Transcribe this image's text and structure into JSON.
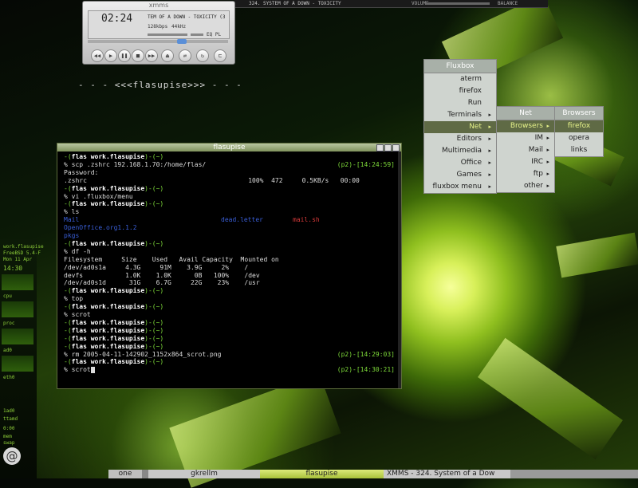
{
  "xmms": {
    "title": "xmms",
    "time": "02:24",
    "song": "TEM OF A DOWN - TOXICITY (3:3",
    "kbps": "128kbps",
    "khz": "44kHz",
    "eq_label": "EQ",
    "pl_label": "PL",
    "buttons": [
      "◀◀",
      "▶",
      "❚❚",
      "■",
      "▶▶",
      "⏏",
      "⇄",
      "↻",
      "⊏"
    ]
  },
  "topstrip": {
    "track": "324. SYSTEM OF A DOWN - TOXICITY",
    "volume": "VOLUME",
    "balance": "BALANCE"
  },
  "banner": "- - - <<<flasupise>>> - - -",
  "fluxbox_menu": {
    "title": "Fluxbox",
    "items": [
      "aterm",
      "firefox",
      "Run",
      "Terminals",
      "Net",
      "Editors",
      "Multimedia",
      "Office",
      "Games",
      "fluxbox menu"
    ],
    "submenu_items": [
      false,
      false,
      false,
      true,
      true,
      true,
      true,
      true,
      true,
      true
    ]
  },
  "net_menu": {
    "title": "Net",
    "items": [
      "Browsers",
      "IM",
      "Mail",
      "IRC",
      "ftp",
      "other"
    ]
  },
  "browsers_menu": {
    "title": "Browsers",
    "items": [
      "firefox",
      "opera",
      "links"
    ]
  },
  "terminal": {
    "title": "flasupise",
    "prompt_host": "flas work.flasupise",
    "lines": [
      {
        "prompt": true,
        "cmd": ""
      },
      {
        "prompt": false,
        "cmd": "% scp .zshrc 192.168.1.70:/home/flas/"
      },
      {
        "prompt": false,
        "cmd": "Password:"
      },
      {
        "prompt": false,
        "cmd": ".zshrc                                          100%  472     0.5KB/s   00:00"
      },
      {
        "prompt": true,
        "cmd": ""
      },
      {
        "prompt": false,
        "cmd": "% vi .fluxbox/menu"
      },
      {
        "prompt": true,
        "cmd": ""
      },
      {
        "prompt": false,
        "cmd": "% ls"
      },
      {
        "prompt": false,
        "cmd": "Mail"
      },
      {
        "prompt": false,
        "cmd": "OpenOffice.org1.1.2"
      },
      {
        "prompt": false,
        "cmd": "pkgs"
      },
      {
        "prompt": true,
        "cmd": ""
      },
      {
        "prompt": false,
        "cmd": "% df -h"
      },
      {
        "prompt": false,
        "cmd": "Filesystem     Size    Used   Avail Capacity  Mounted on"
      },
      {
        "prompt": false,
        "cmd": "/dev/ad0s1a     4.3G     91M    3.9G     2%    /"
      },
      {
        "prompt": false,
        "cmd": "devfs           1.0K    1.0K      0B   100%    /dev"
      },
      {
        "prompt": false,
        "cmd": "/dev/ad0s1d      31G    6.7G     22G    23%    /usr"
      },
      {
        "prompt": true,
        "cmd": ""
      },
      {
        "prompt": false,
        "cmd": "% top"
      },
      {
        "prompt": true,
        "cmd": ""
      },
      {
        "prompt": false,
        "cmd": "% scrot"
      },
      {
        "prompt": true,
        "cmd": ""
      },
      {
        "prompt": true,
        "cmd": ""
      },
      {
        "prompt": true,
        "cmd": ""
      },
      {
        "prompt": true,
        "cmd": ""
      },
      {
        "prompt": false,
        "cmd": "% rm 2005-04-11-142902_1152x864_scrot.png"
      },
      {
        "prompt": true,
        "cmd": ""
      },
      {
        "prompt": false,
        "cmd": "% scrot"
      }
    ],
    "right_stamps": [
      {
        "line": 1,
        "text": "(p2)-[14:24:59]"
      },
      {
        "line": 25,
        "text": "(p2)-[14:29:03]"
      },
      {
        "line": 27,
        "text": "(p2)-[14:30:21]"
      }
    ],
    "ls_cols": [
      "Mail",
      "dead.letter",
      "mail.sh"
    ]
  },
  "gkrellm": {
    "host": "work.flasupise",
    "os": "FreeBSD 5.4-F",
    "date": "Mon 11 Apr",
    "clock": "14:30",
    "labels": [
      "cpu",
      "proc",
      "ad0",
      "eth0"
    ],
    "bottom": [
      "1ad0",
      "ttamd",
      "0:00",
      "mem",
      "swap"
    ]
  },
  "taskbar": {
    "workspace": "one",
    "items": [
      "gkrellm",
      "flasupise",
      "XMMS - 324. System of a Dow"
    ]
  }
}
